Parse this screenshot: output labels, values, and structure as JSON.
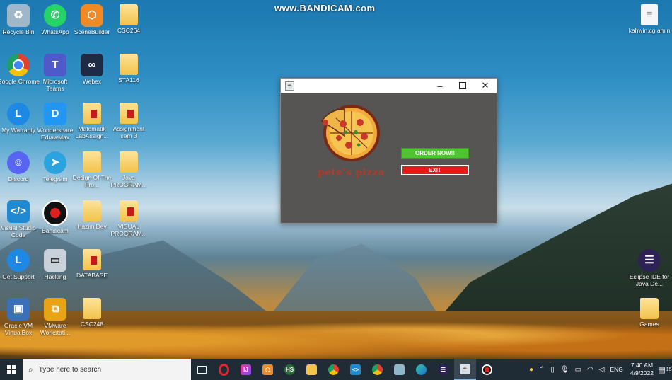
{
  "watermark": "www.BANDICAM.com",
  "desktop_icons": [
    {
      "label": "Recycle Bin",
      "icon": "recycle-bin-icon",
      "color": "#9fb7c9"
    },
    {
      "label": "WhatsApp",
      "icon": "whatsapp-icon",
      "color": "#25d366"
    },
    {
      "label": "SceneBuilder",
      "icon": "scenebuilder-icon",
      "color": "#f08a24"
    },
    {
      "label": "CSC264",
      "icon": "folder-icon"
    },
    {
      "label": "Google Chrome",
      "icon": "chrome-icon",
      "color": "#e0402f"
    },
    {
      "label": "Microsoft Teams",
      "icon": "teams-icon",
      "color": "#5059c9"
    },
    {
      "label": "Webex",
      "icon": "webex-icon",
      "color": "#1f2a44"
    },
    {
      "label": "STA116",
      "icon": "folder-icon"
    },
    {
      "label": "My Warranty",
      "icon": "warranty-icon",
      "color": "#1e88e5"
    },
    {
      "label": "Wondershare EdrawMax",
      "icon": "edrawmax-icon",
      "color": "#2196f3"
    },
    {
      "label": "Matematik LabAssign...",
      "icon": "folder-icon"
    },
    {
      "label": "Assignment sem 3",
      "icon": "folder-icon"
    },
    {
      "label": "Discord",
      "icon": "discord-icon",
      "color": "#5865f2"
    },
    {
      "label": "Telegram",
      "icon": "telegram-icon",
      "color": "#2aa3df"
    },
    {
      "label": "Design Of The Pro...",
      "icon": "folder-icon"
    },
    {
      "label": "Java PROGRAM...",
      "icon": "folder-icon"
    },
    {
      "label": "Visual Studio Code",
      "icon": "vscode-icon",
      "color": "#1f8ad2"
    },
    {
      "label": "Bandicam",
      "icon": "bandicam-icon",
      "color": "#e02020"
    },
    {
      "label": "Hazim Dev",
      "icon": "folder-icon"
    },
    {
      "label": "VISUAL PROGRAM...",
      "icon": "folder-icon"
    },
    {
      "label": "Get Support",
      "icon": "support-icon",
      "color": "#1e88e5"
    },
    {
      "label": "Hacking",
      "icon": "hacking-icon",
      "color": "#c9d2da"
    },
    {
      "label": "DATABASE",
      "icon": "folder-icon"
    },
    {
      "label": "Oracle VM VirtualBox",
      "icon": "virtualbox-icon",
      "color": "#3b6fb6"
    },
    {
      "label": "VMware Workstati...",
      "icon": "vmware-icon",
      "color": "#e8a317"
    },
    {
      "label": "CSC248",
      "icon": "folder-icon"
    },
    {
      "label": "kahwin.cg amin",
      "icon": "document-icon"
    },
    {
      "label": "Eclipse IDE for Java De...",
      "icon": "eclipse-icon",
      "color": "#2c2255"
    },
    {
      "label": "Games",
      "icon": "folder-icon"
    }
  ],
  "app_window": {
    "brand": "pete's pizza",
    "order_button": "ORDER NOW!!",
    "exit_button": "EXIT",
    "minimize": "–",
    "close": "✕",
    "order_color": "#4fc431",
    "exit_color": "#e51a1a",
    "background": "#575454"
  },
  "taskbar": {
    "search_placeholder": "Type here to search",
    "apps": [
      "task-view-icon",
      "opera-icon",
      "intellij-icon",
      "scenebuilder-icon",
      "hs-icon",
      "file-explorer-icon",
      "chrome-icon",
      "vscode-icon",
      "chrome-alt-icon",
      "notepad-icon",
      "edge-icon",
      "eclipse-icon",
      "java-app-icon",
      "bandicam-icon"
    ],
    "language": "ENG",
    "time": "7:40 AM",
    "date": "4/9/2022",
    "notifications": "15"
  }
}
